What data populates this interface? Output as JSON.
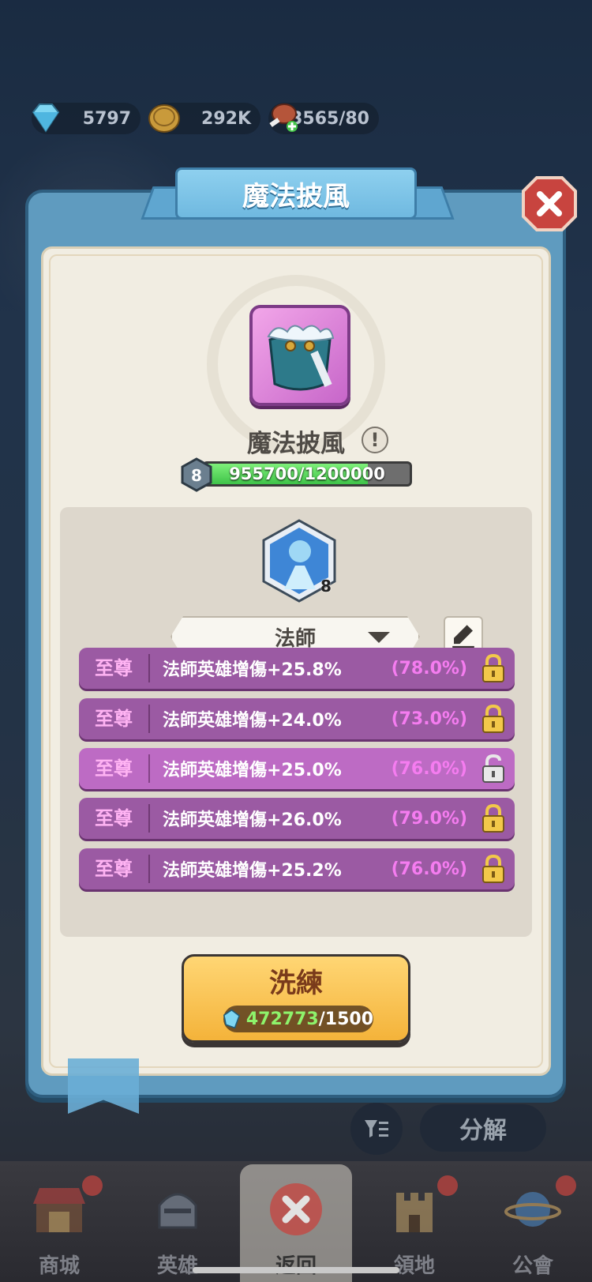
{
  "resources": {
    "gems": "5797",
    "coins": "292K",
    "stamina": "3565/80"
  },
  "dialog": {
    "title": "魔法披風",
    "item_name": "魔法披風",
    "info_icon_char": "!",
    "level": "8",
    "progress_text": "955700/1200000",
    "progress": {
      "current": 955700,
      "max": 1200000
    },
    "class_level": "8",
    "class_select": "法師",
    "stats": [
      {
        "tier": "至尊",
        "text": "法師英雄增傷+25.8%",
        "pct": "(78.0%)",
        "locked": true
      },
      {
        "tier": "至尊",
        "text": "法師英雄增傷+24.0%",
        "pct": "(73.0%)",
        "locked": true
      },
      {
        "tier": "至尊",
        "text": "法師英雄增傷+25.0%",
        "pct": "(76.0%)",
        "locked": false
      },
      {
        "tier": "至尊",
        "text": "法師英雄增傷+26.0%",
        "pct": "(79.0%)",
        "locked": true
      },
      {
        "tier": "至尊",
        "text": "法師英雄增傷+25.2%",
        "pct": "(76.0%)",
        "locked": true
      }
    ],
    "reroll": {
      "label": "洗練",
      "have": "472773",
      "need": "/1500"
    }
  },
  "behind": {
    "decompose_label": "分解"
  },
  "nav": {
    "shop": "商城",
    "heroes": "英雄",
    "back": "返回",
    "territory": "領地",
    "guild": "公會"
  },
  "colors": {
    "panel_blue": "#5f9bbf",
    "row_purple": "#9b5aa3",
    "row_purple_unlocked": "#bd6bc4",
    "tier_pink": "#ffb3f3",
    "pct_pink": "#f57cf0",
    "progress_green": "#3fc349",
    "reroll_gold": "#f4b33a"
  }
}
